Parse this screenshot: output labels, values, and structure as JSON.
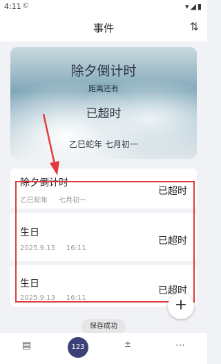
{
  "status_bar": {
    "time": "4:11",
    "c_icon": "copyright-icon",
    "right_icons": "▾◢▮"
  },
  "appbar": {
    "title": "事件",
    "sort_icon": "sort-icon"
  },
  "hero": {
    "title": "除夕倒计时",
    "subtitle": "距离还有",
    "status": "已超时",
    "lunar_date": "乙巳蛇年 七月初一"
  },
  "events": [
    {
      "name": "除夕倒计时",
      "meta1": "乙巳蛇年",
      "meta2": "七月初一",
      "status": "已超时"
    },
    {
      "name": "生日",
      "meta1": "2025.9.13",
      "meta2": "16:11",
      "status": "已超时"
    },
    {
      "name": "生日",
      "meta1": "2025.9.13",
      "meta2": "16:11",
      "status": "已超时"
    }
  ],
  "fab": {
    "label": "+"
  },
  "toast": "保存成功",
  "bottom_nav": {
    "calendar_icon": "calendar-icon",
    "counter_label": "123",
    "calculator_icon": "calculator-icon",
    "more_icon": "more-icon"
  },
  "colors": {
    "highlight": "#e23a3a",
    "badge": "#3c4178"
  }
}
